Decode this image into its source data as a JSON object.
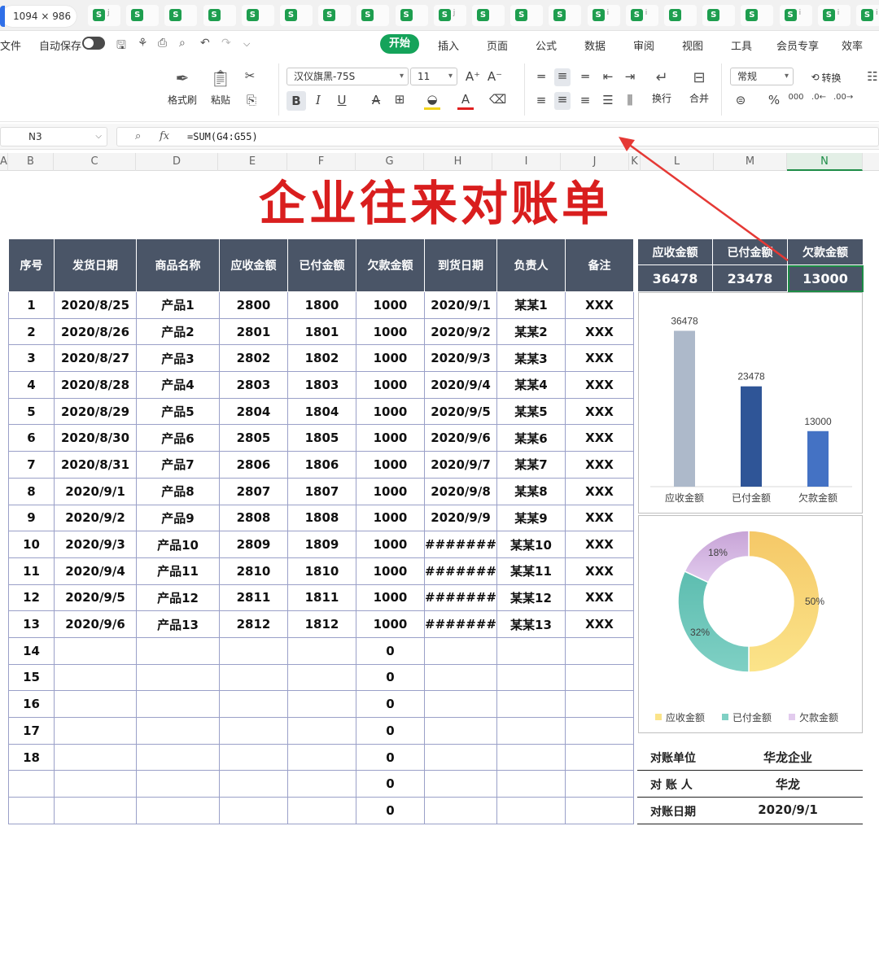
{
  "tabbar": {
    "size_label": "1094 × 986",
    "doc_icon_letter": "S",
    "tabs": [
      {
        "tail": "j"
      },
      {
        "tail": ""
      },
      {
        "tail": ""
      },
      {
        "tail": ""
      },
      {
        "tail": ""
      },
      {
        "tail": ""
      },
      {
        "tail": ""
      },
      {
        "tail": ""
      },
      {
        "tail": ""
      },
      {
        "tail": "j"
      },
      {
        "tail": ""
      },
      {
        "tail": ""
      },
      {
        "tail": ""
      },
      {
        "tail": "i"
      },
      {
        "tail": "i"
      },
      {
        "tail": ""
      },
      {
        "tail": ""
      },
      {
        "tail": ""
      },
      {
        "tail": "i"
      },
      {
        "tail": "i"
      },
      {
        "tail": "i"
      }
    ]
  },
  "menubar": {
    "file": "文件",
    "autosave": "自动保存",
    "tabs": [
      "开始",
      "插入",
      "页面",
      "公式",
      "数据",
      "审阅",
      "视图",
      "工具",
      "会员专享",
      "效率"
    ]
  },
  "ribbon": {
    "format_painter": "格式刷",
    "paste": "粘贴",
    "font_name": "汉仪旗黑-75S",
    "font_size": "11",
    "wrap": "换行",
    "merge": "合并",
    "number_format": "常规",
    "convert": "转换",
    "bold": "B",
    "italic": "I",
    "underline": "U",
    "strike": "A",
    "percent": "%"
  },
  "formulabar": {
    "cell": "N3",
    "fx": "fx",
    "formula": "=SUM(G4:G55)"
  },
  "columns": [
    "A",
    "B",
    "C",
    "D",
    "E",
    "F",
    "G",
    "H",
    "I",
    "J",
    "K",
    "L",
    "M",
    "N"
  ],
  "sheet": {
    "title": "企业往来对账单",
    "headers": [
      "序号",
      "发货日期",
      "商品名称",
      "应收金额",
      "已付金额",
      "欠款金额",
      "到货日期",
      "负责人",
      "备注"
    ],
    "rows": [
      [
        "1",
        "2020/8/25",
        "产品1",
        "2800",
        "1800",
        "1000",
        "2020/9/1",
        "某某1",
        "XXX"
      ],
      [
        "2",
        "2020/8/26",
        "产品2",
        "2801",
        "1801",
        "1000",
        "2020/9/2",
        "某某2",
        "XXX"
      ],
      [
        "3",
        "2020/8/27",
        "产品3",
        "2802",
        "1802",
        "1000",
        "2020/9/3",
        "某某3",
        "XXX"
      ],
      [
        "4",
        "2020/8/28",
        "产品4",
        "2803",
        "1803",
        "1000",
        "2020/9/4",
        "某某4",
        "XXX"
      ],
      [
        "5",
        "2020/8/29",
        "产品5",
        "2804",
        "1804",
        "1000",
        "2020/9/5",
        "某某5",
        "XXX"
      ],
      [
        "6",
        "2020/8/30",
        "产品6",
        "2805",
        "1805",
        "1000",
        "2020/9/6",
        "某某6",
        "XXX"
      ],
      [
        "7",
        "2020/8/31",
        "产品7",
        "2806",
        "1806",
        "1000",
        "2020/9/7",
        "某某7",
        "XXX"
      ],
      [
        "8",
        "2020/9/1",
        "产品8",
        "2807",
        "1807",
        "1000",
        "2020/9/8",
        "某某8",
        "XXX"
      ],
      [
        "9",
        "2020/9/2",
        "产品9",
        "2808",
        "1808",
        "1000",
        "2020/9/9",
        "某某9",
        "XXX"
      ],
      [
        "10",
        "2020/9/3",
        "产品10",
        "2809",
        "1809",
        "1000",
        "#######",
        "某某10",
        "XXX"
      ],
      [
        "11",
        "2020/9/4",
        "产品11",
        "2810",
        "1810",
        "1000",
        "#######",
        "某某11",
        "XXX"
      ],
      [
        "12",
        "2020/9/5",
        "产品12",
        "2811",
        "1811",
        "1000",
        "#######",
        "某某12",
        "XXX"
      ],
      [
        "13",
        "2020/9/6",
        "产品13",
        "2812",
        "1812",
        "1000",
        "#######",
        "某某13",
        "XXX"
      ],
      [
        "14",
        "",
        "",
        "",
        "",
        "0",
        "",
        "",
        ""
      ],
      [
        "15",
        "",
        "",
        "",
        "",
        "0",
        "",
        "",
        ""
      ],
      [
        "16",
        "",
        "",
        "",
        "",
        "0",
        "",
        "",
        ""
      ],
      [
        "17",
        "",
        "",
        "",
        "",
        "0",
        "",
        "",
        ""
      ],
      [
        "18",
        "",
        "",
        "",
        "",
        "0",
        "",
        "",
        ""
      ],
      [
        "",
        "",
        "",
        "",
        "",
        "0",
        "",
        "",
        ""
      ],
      [
        "",
        "",
        "",
        "",
        "",
        "0",
        "",
        "",
        ""
      ]
    ]
  },
  "summary": {
    "headers": [
      "应收金额",
      "已付金额",
      "欠款金额"
    ],
    "values": [
      "36478",
      "23478",
      "13000"
    ]
  },
  "info": {
    "rows": [
      {
        "label": "对账单位",
        "value": "华龙企业"
      },
      {
        "label": "对 账 人",
        "value": "华龙"
      },
      {
        "label": "对账日期",
        "value": "2020/9/1"
      }
    ]
  },
  "colors": {
    "accent_green": "#15a35a",
    "header_dark": "#4a5567",
    "title_red": "#d91e1e",
    "bar1": "#adb9ca",
    "bar2": "#2f5597",
    "bar3": "#4472c4",
    "donut1": "#f5c867",
    "donut2": "#5dbdb0",
    "donut3": "#c7a3d6"
  },
  "chart_data": [
    {
      "type": "bar",
      "categories": [
        "应收金额",
        "已付金额",
        "欠款金额"
      ],
      "values": [
        36478,
        23478,
        13000
      ],
      "data_labels": [
        "36478",
        "23478",
        "13000"
      ],
      "title": "",
      "ylim": [
        0,
        40000
      ],
      "grid": false,
      "legend": "none"
    },
    {
      "type": "pie",
      "donut": true,
      "categories": [
        "应收金额",
        "已付金额",
        "欠款金额"
      ],
      "values": [
        50,
        32,
        18
      ],
      "data_labels": [
        "50%",
        "32%",
        "18%"
      ],
      "legend": "bottom",
      "title": ""
    }
  ]
}
